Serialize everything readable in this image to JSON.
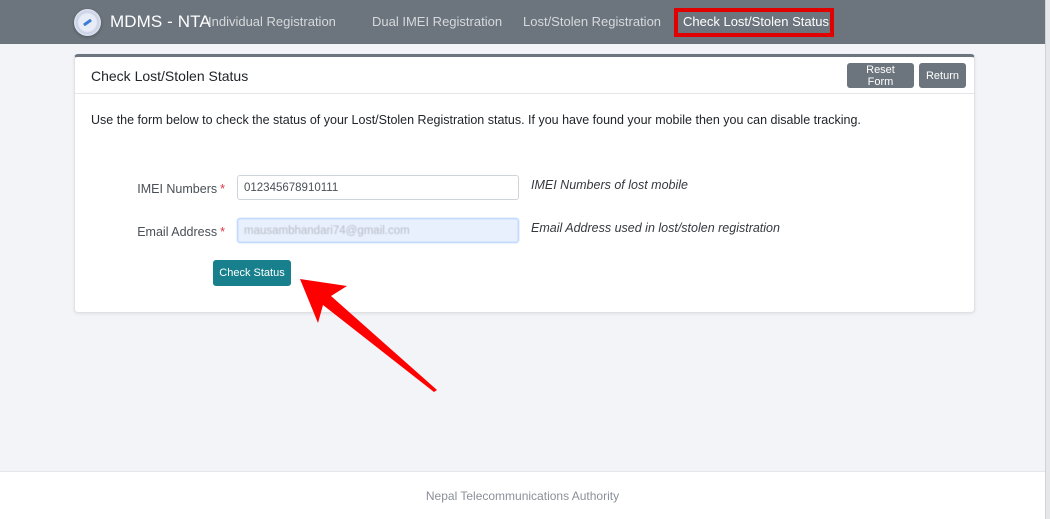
{
  "navbar": {
    "brand": "MDMS - NTA",
    "logo_icon": "nta-emblem-logo",
    "items": [
      {
        "label": "Individual Registration",
        "active": false
      },
      {
        "label": "Dual IMEI Registration",
        "active": false
      },
      {
        "label": "Lost/Stolen Registration",
        "active": false
      },
      {
        "label": "Check Lost/Stolen Status",
        "active": true
      }
    ],
    "highlight_color": "#e00000"
  },
  "card": {
    "title": "Check Lost/Stolen Status",
    "reset_label": "Reset Form",
    "return_label": "Return",
    "intro": "Use the form below to check the status of your Lost/Stolen Registration status. If you have found your mobile then you can disable tracking.",
    "form": {
      "imei": {
        "label": "IMEI Numbers",
        "required_mark": "*",
        "value": "012345678910111",
        "help": "IMEI Numbers of lost mobile"
      },
      "email": {
        "label": "Email Address",
        "required_mark": "*",
        "value": "mausambhandari74@gmail.com",
        "help": "Email Address used in lost/stolen registration"
      },
      "submit_label": "Check Status"
    }
  },
  "annotation": {
    "arrow_color": "#ff0000",
    "points_to": "Check Status"
  },
  "footer": {
    "text": "Nepal Telecommunications Authority"
  },
  "colors": {
    "navbar": "#6c757d",
    "primary_button": "#17808c",
    "secondary_button": "#6c757d",
    "required": "#dc3545"
  }
}
